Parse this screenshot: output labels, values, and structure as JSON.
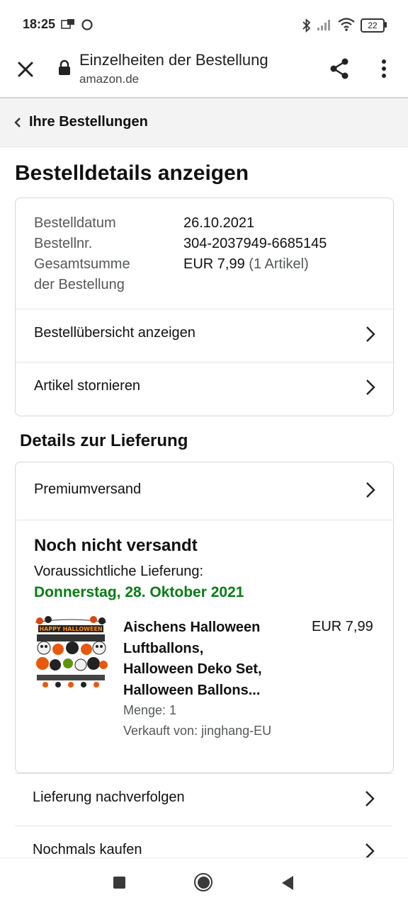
{
  "status_bar": {
    "time": "18:25",
    "battery": "22"
  },
  "browser": {
    "title": "Einzelheiten der Bestellung",
    "url": "amazon.de"
  },
  "breadcrumb": {
    "label": "Ihre Bestellungen"
  },
  "page_title": "Bestelldetails anzeigen",
  "order_summary": {
    "date_label": "Bestelldatum",
    "date_value": "26.10.2021",
    "number_label": "Bestellnr.",
    "number_value": "304-2037949-6685145",
    "total_label_line1": "Gesamtsumme",
    "total_label_line2": "der Bestellung",
    "total_value": "EUR 7,99",
    "total_items": "(1 Artikel)",
    "rows": [
      {
        "label": "Bestellübersicht anzeigen"
      },
      {
        "label": "Artikel stornieren"
      }
    ]
  },
  "delivery": {
    "heading": "Details zur Lieferung",
    "shipping_method": "Premiumversand",
    "status": "Noch nicht versandt",
    "eta_label": "Voraussichtliche Lieferung:",
    "eta_date": "Donnerstag, 28. Oktober 2021",
    "item": {
      "title_lines": [
        "Aischens Halloween",
        "Luftballons,",
        "Halloween Deko Set,",
        "Halloween Ballons..."
      ],
      "price": "EUR 7,99",
      "quantity": "Menge: 1",
      "seller": "Verkauft von: jinghang-EU",
      "image_caption": "HAPPY HALLOWEEN"
    }
  },
  "actions": [
    {
      "label": "Lieferung nachverfolgen"
    },
    {
      "label": "Nochmals kaufen"
    }
  ],
  "colors": {
    "eta_green": "#067d14",
    "border": "#d5d9d9",
    "muted_text": "#565959"
  }
}
